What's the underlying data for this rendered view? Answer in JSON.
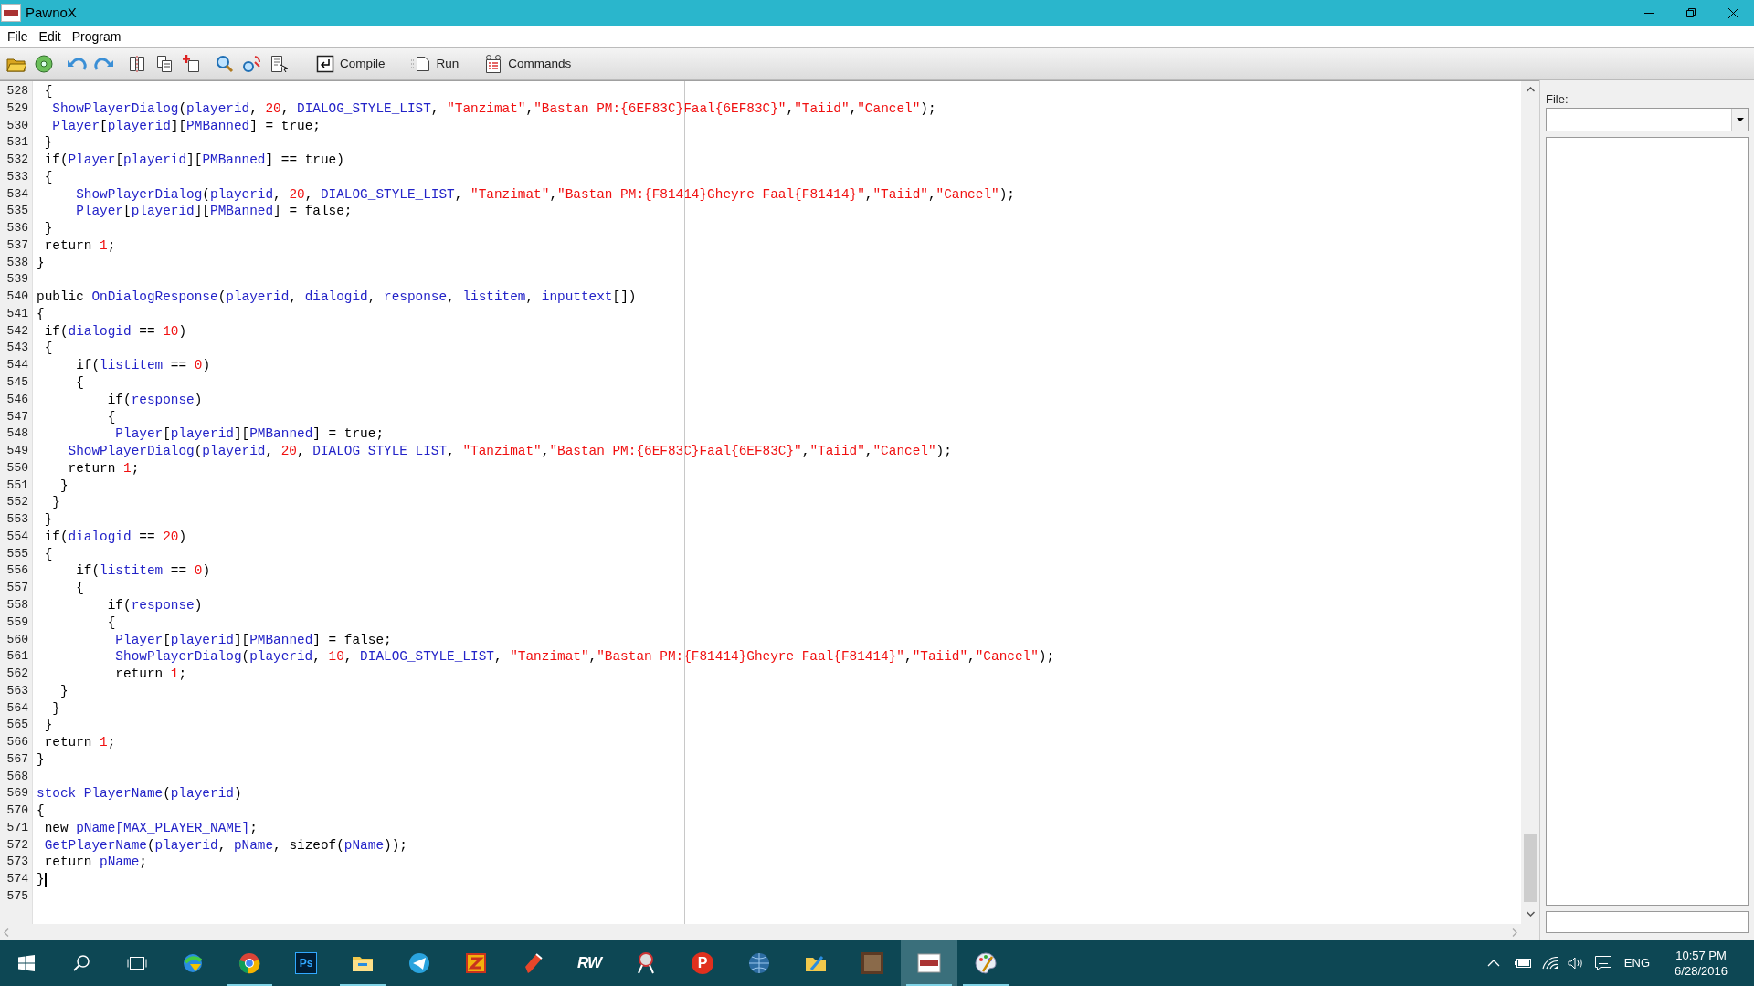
{
  "window": {
    "title": "PawnoX"
  },
  "menu": [
    {
      "label": "File"
    },
    {
      "label": "Edit"
    },
    {
      "label": "Program"
    }
  ],
  "toolbar": [
    {
      "kind": "open"
    },
    {
      "kind": "save"
    },
    {
      "kind": "undo"
    },
    {
      "kind": "redo"
    },
    {
      "kind": "cut"
    },
    {
      "kind": "copy"
    },
    {
      "kind": "paste"
    },
    {
      "kind": "find"
    },
    {
      "kind": "replace"
    },
    {
      "kind": "goto"
    },
    {
      "kind": "compile",
      "label": "Compile"
    },
    {
      "kind": "run",
      "label": "Run"
    },
    {
      "kind": "commands",
      "label": "Commands"
    }
  ],
  "editor": {
    "lines": [
      {
        "number": "528",
        "caret": false,
        "segments": [
          {
            "kind": "plain",
            "text": " {"
          }
        ]
      },
      {
        "number": "529",
        "caret": false,
        "segments": [
          {
            "kind": "name",
            "text": "  ShowPlayerDialog"
          },
          {
            "kind": "plain",
            "text": "("
          },
          {
            "kind": "name",
            "text": "playerid"
          },
          {
            "kind": "plain",
            "text": ", "
          },
          {
            "kind": "number",
            "text": "20"
          },
          {
            "kind": "plain",
            "text": ", "
          },
          {
            "kind": "name",
            "text": "DIALOG_STYLE_LIST"
          },
          {
            "kind": "plain",
            "text": ", "
          },
          {
            "kind": "string",
            "text": "\"Tanzimat\""
          },
          {
            "kind": "plain",
            "text": ","
          },
          {
            "kind": "string",
            "text": "\"Bastan PM:{6EF83C}Faal{6EF83C}\""
          },
          {
            "kind": "plain",
            "text": ","
          },
          {
            "kind": "string",
            "text": "\"Taiid\""
          },
          {
            "kind": "plain",
            "text": ","
          },
          {
            "kind": "string",
            "text": "\"Cancel\""
          },
          {
            "kind": "plain",
            "text": ");"
          }
        ]
      },
      {
        "number": "530",
        "caret": false,
        "segments": [
          {
            "kind": "name",
            "text": "  Player"
          },
          {
            "kind": "plain",
            "text": "["
          },
          {
            "kind": "name",
            "text": "playerid"
          },
          {
            "kind": "plain",
            "text": "]["
          },
          {
            "kind": "name",
            "text": "PMBanned"
          },
          {
            "kind": "plain",
            "text": "] = true;"
          }
        ]
      },
      {
        "number": "531",
        "caret": false,
        "segments": [
          {
            "kind": "plain",
            "text": " }"
          }
        ]
      },
      {
        "number": "532",
        "caret": false,
        "segments": [
          {
            "kind": "plain",
            "text": " if("
          },
          {
            "kind": "name",
            "text": "Player"
          },
          {
            "kind": "plain",
            "text": "["
          },
          {
            "kind": "name",
            "text": "playerid"
          },
          {
            "kind": "plain",
            "text": "]["
          },
          {
            "kind": "name",
            "text": "PMBanned"
          },
          {
            "kind": "plain",
            "text": "] == true)"
          }
        ]
      },
      {
        "number": "533",
        "caret": false,
        "segments": [
          {
            "kind": "plain",
            "text": " {"
          }
        ]
      },
      {
        "number": "534",
        "caret": false,
        "segments": [
          {
            "kind": "name",
            "text": "     ShowPlayerDialog"
          },
          {
            "kind": "plain",
            "text": "("
          },
          {
            "kind": "name",
            "text": "playerid"
          },
          {
            "kind": "plain",
            "text": ", "
          },
          {
            "kind": "number",
            "text": "20"
          },
          {
            "kind": "plain",
            "text": ", "
          },
          {
            "kind": "name",
            "text": "DIALOG_STYLE_LIST"
          },
          {
            "kind": "plain",
            "text": ", "
          },
          {
            "kind": "string",
            "text": "\"Tanzimat\""
          },
          {
            "kind": "plain",
            "text": ","
          },
          {
            "kind": "string",
            "text": "\"Bastan PM:{F81414}Gheyre Faal{F81414}\""
          },
          {
            "kind": "plain",
            "text": ","
          },
          {
            "kind": "string",
            "text": "\"Taiid\""
          },
          {
            "kind": "plain",
            "text": ","
          },
          {
            "kind": "string",
            "text": "\"Cancel\""
          },
          {
            "kind": "plain",
            "text": ");"
          }
        ]
      },
      {
        "number": "535",
        "caret": false,
        "segments": [
          {
            "kind": "name",
            "text": "     Player"
          },
          {
            "kind": "plain",
            "text": "["
          },
          {
            "kind": "name",
            "text": "playerid"
          },
          {
            "kind": "plain",
            "text": "]["
          },
          {
            "kind": "name",
            "text": "PMBanned"
          },
          {
            "kind": "plain",
            "text": "] = false;"
          }
        ]
      },
      {
        "number": "536",
        "caret": false,
        "segments": [
          {
            "kind": "plain",
            "text": " }"
          }
        ]
      },
      {
        "number": "537",
        "caret": false,
        "segments": [
          {
            "kind": "plain",
            "text": " return "
          },
          {
            "kind": "number",
            "text": "1"
          },
          {
            "kind": "plain",
            "text": ";"
          }
        ]
      },
      {
        "number": "538",
        "caret": false,
        "segments": [
          {
            "kind": "plain",
            "text": "}"
          }
        ]
      },
      {
        "number": "539",
        "caret": false
      },
      {
        "number": "540",
        "caret": false,
        "segments": [
          {
            "kind": "plain",
            "text": "public "
          },
          {
            "kind": "name",
            "text": "OnDialogResponse"
          },
          {
            "kind": "plain",
            "text": "("
          },
          {
            "kind": "name",
            "text": "playerid"
          },
          {
            "kind": "plain",
            "text": ", "
          },
          {
            "kind": "name",
            "text": "dialogid"
          },
          {
            "kind": "plain",
            "text": ", "
          },
          {
            "kind": "name",
            "text": "response"
          },
          {
            "kind": "plain",
            "text": ", "
          },
          {
            "kind": "name",
            "text": "listitem"
          },
          {
            "kind": "plain",
            "text": ", "
          },
          {
            "kind": "name",
            "text": "inputtext"
          },
          {
            "kind": "plain",
            "text": "[])"
          }
        ]
      },
      {
        "number": "541",
        "caret": false,
        "segments": [
          {
            "kind": "plain",
            "text": "{"
          }
        ]
      },
      {
        "number": "542",
        "caret": false,
        "segments": [
          {
            "kind": "plain",
            "text": " if("
          },
          {
            "kind": "name",
            "text": "dialogid"
          },
          {
            "kind": "plain",
            "text": " == "
          },
          {
            "kind": "number",
            "text": "10"
          },
          {
            "kind": "plain",
            "text": ")"
          }
        ]
      },
      {
        "number": "543",
        "caret": false,
        "segments": [
          {
            "kind": "plain",
            "text": " {"
          }
        ]
      },
      {
        "number": "544",
        "caret": false,
        "segments": [
          {
            "kind": "plain",
            "text": "     if("
          },
          {
            "kind": "name",
            "text": "listitem"
          },
          {
            "kind": "plain",
            "text": " == "
          },
          {
            "kind": "number",
            "text": "0"
          },
          {
            "kind": "plain",
            "text": ")"
          }
        ]
      },
      {
        "number": "545",
        "caret": false,
        "segments": [
          {
            "kind": "plain",
            "text": "     {"
          }
        ]
      },
      {
        "number": "546",
        "caret": false,
        "segments": [
          {
            "kind": "plain",
            "text": "         if("
          },
          {
            "kind": "name",
            "text": "response"
          },
          {
            "kind": "plain",
            "text": ")"
          }
        ]
      },
      {
        "number": "547",
        "caret": false,
        "segments": [
          {
            "kind": "plain",
            "text": "         {"
          }
        ]
      },
      {
        "number": "548",
        "caret": false,
        "segments": [
          {
            "kind": "name",
            "text": "          Player"
          },
          {
            "kind": "plain",
            "text": "["
          },
          {
            "kind": "name",
            "text": "playerid"
          },
          {
            "kind": "plain",
            "text": "]["
          },
          {
            "kind": "name",
            "text": "PMBanned"
          },
          {
            "kind": "plain",
            "text": "] = true;"
          }
        ]
      },
      {
        "number": "549",
        "caret": false,
        "segments": [
          {
            "kind": "name",
            "text": "    ShowPlayerDialog"
          },
          {
            "kind": "plain",
            "text": "("
          },
          {
            "kind": "name",
            "text": "playerid"
          },
          {
            "kind": "plain",
            "text": ", "
          },
          {
            "kind": "number",
            "text": "20"
          },
          {
            "kind": "plain",
            "text": ", "
          },
          {
            "kind": "name",
            "text": "DIALOG_STYLE_LIST"
          },
          {
            "kind": "plain",
            "text": ", "
          },
          {
            "kind": "string",
            "text": "\"Tanzimat\""
          },
          {
            "kind": "plain",
            "text": ","
          },
          {
            "kind": "string",
            "text": "\"Bastan PM:{6EF83C}Faal{6EF83C}\""
          },
          {
            "kind": "plain",
            "text": ","
          },
          {
            "kind": "string",
            "text": "\"Taiid\""
          },
          {
            "kind": "plain",
            "text": ","
          },
          {
            "kind": "string",
            "text": "\"Cancel\""
          },
          {
            "kind": "plain",
            "text": ");"
          }
        ]
      },
      {
        "number": "550",
        "caret": false,
        "segments": [
          {
            "kind": "plain",
            "text": "    return "
          },
          {
            "kind": "number",
            "text": "1"
          },
          {
            "kind": "plain",
            "text": ";"
          }
        ]
      },
      {
        "number": "551",
        "caret": false,
        "segments": [
          {
            "kind": "plain",
            "text": "   }"
          }
        ]
      },
      {
        "number": "552",
        "caret": false,
        "segments": [
          {
            "kind": "plain",
            "text": "  }"
          }
        ]
      },
      {
        "number": "553",
        "caret": false,
        "segments": [
          {
            "kind": "plain",
            "text": " }"
          }
        ]
      },
      {
        "number": "554",
        "caret": false,
        "segments": [
          {
            "kind": "plain",
            "text": " if("
          },
          {
            "kind": "name",
            "text": "dialogid"
          },
          {
            "kind": "plain",
            "text": " == "
          },
          {
            "kind": "number",
            "text": "20"
          },
          {
            "kind": "plain",
            "text": ")"
          }
        ]
      },
      {
        "number": "555",
        "caret": false,
        "segments": [
          {
            "kind": "plain",
            "text": " {"
          }
        ]
      },
      {
        "number": "556",
        "caret": false,
        "segments": [
          {
            "kind": "plain",
            "text": "     if("
          },
          {
            "kind": "name",
            "text": "listitem"
          },
          {
            "kind": "plain",
            "text": " == "
          },
          {
            "kind": "number",
            "text": "0"
          },
          {
            "kind": "plain",
            "text": ")"
          }
        ]
      },
      {
        "number": "557",
        "caret": false,
        "segments": [
          {
            "kind": "plain",
            "text": "     {"
          }
        ]
      },
      {
        "number": "558",
        "caret": false,
        "segments": [
          {
            "kind": "plain",
            "text": "         if("
          },
          {
            "kind": "name",
            "text": "response"
          },
          {
            "kind": "plain",
            "text": ")"
          }
        ]
      },
      {
        "number": "559",
        "caret": false,
        "segments": [
          {
            "kind": "plain",
            "text": "         {"
          }
        ]
      },
      {
        "number": "560",
        "caret": false,
        "segments": [
          {
            "kind": "name",
            "text": "          Player"
          },
          {
            "kind": "plain",
            "text": "["
          },
          {
            "kind": "name",
            "text": "playerid"
          },
          {
            "kind": "plain",
            "text": "]["
          },
          {
            "kind": "name",
            "text": "PMBanned"
          },
          {
            "kind": "plain",
            "text": "] = false;"
          }
        ]
      },
      {
        "number": "561",
        "caret": false,
        "segments": [
          {
            "kind": "name",
            "text": "          ShowPlayerDialog"
          },
          {
            "kind": "plain",
            "text": "("
          },
          {
            "kind": "name",
            "text": "playerid"
          },
          {
            "kind": "plain",
            "text": ", "
          },
          {
            "kind": "number",
            "text": "10"
          },
          {
            "kind": "plain",
            "text": ", "
          },
          {
            "kind": "name",
            "text": "DIALOG_STYLE_LIST"
          },
          {
            "kind": "plain",
            "text": ", "
          },
          {
            "kind": "string",
            "text": "\"Tanzimat\""
          },
          {
            "kind": "plain",
            "text": ","
          },
          {
            "kind": "string",
            "text": "\"Bastan PM:{F81414}Gheyre Faal{F81414}\""
          },
          {
            "kind": "plain",
            "text": ","
          },
          {
            "kind": "string",
            "text": "\"Taiid\""
          },
          {
            "kind": "plain",
            "text": ","
          },
          {
            "kind": "string",
            "text": "\"Cancel\""
          },
          {
            "kind": "plain",
            "text": ");"
          }
        ]
      },
      {
        "number": "562",
        "caret": false,
        "segments": [
          {
            "kind": "plain",
            "text": "          return "
          },
          {
            "kind": "number",
            "text": "1"
          },
          {
            "kind": "plain",
            "text": ";"
          }
        ]
      },
      {
        "number": "563",
        "caret": false,
        "segments": [
          {
            "kind": "plain",
            "text": "   }"
          }
        ]
      },
      {
        "number": "564",
        "caret": false,
        "segments": [
          {
            "kind": "plain",
            "text": "  }"
          }
        ]
      },
      {
        "number": "565",
        "caret": false,
        "segments": [
          {
            "kind": "plain",
            "text": " }"
          }
        ]
      },
      {
        "number": "566",
        "caret": false,
        "segments": [
          {
            "kind": "plain",
            "text": " return "
          },
          {
            "kind": "number",
            "text": "1"
          },
          {
            "kind": "plain",
            "text": ";"
          }
        ]
      },
      {
        "number": "567",
        "caret": false,
        "segments": [
          {
            "kind": "plain",
            "text": "}"
          }
        ]
      },
      {
        "number": "568",
        "caret": false
      },
      {
        "number": "569",
        "caret": false,
        "segments": [
          {
            "kind": "name",
            "text": "stock PlayerName"
          },
          {
            "kind": "plain",
            "text": "("
          },
          {
            "kind": "name",
            "text": "playerid"
          },
          {
            "kind": "plain",
            "text": ")"
          }
        ]
      },
      {
        "number": "570",
        "caret": false,
        "segments": [
          {
            "kind": "plain",
            "text": "{"
          }
        ]
      },
      {
        "number": "571",
        "caret": false,
        "segments": [
          {
            "kind": "plain",
            "text": " new "
          },
          {
            "kind": "name",
            "text": "pName[MAX_PLAYER_NAME]"
          },
          {
            "kind": "plain",
            "text": ";"
          }
        ]
      },
      {
        "number": "572",
        "caret": false,
        "segments": [
          {
            "kind": "name",
            "text": " GetPlayerName"
          },
          {
            "kind": "plain",
            "text": "("
          },
          {
            "kind": "name",
            "text": "playerid"
          },
          {
            "kind": "plain",
            "text": ", "
          },
          {
            "kind": "name",
            "text": "pName"
          },
          {
            "kind": "plain",
            "text": ", sizeof("
          },
          {
            "kind": "name",
            "text": "pName"
          },
          {
            "kind": "plain",
            "text": "));"
          }
        ]
      },
      {
        "number": "573",
        "caret": false,
        "segments": [
          {
            "kind": "plain",
            "text": " return "
          },
          {
            "kind": "name",
            "text": "pName"
          },
          {
            "kind": "plain",
            "text": ";"
          }
        ]
      },
      {
        "number": "574",
        "caret": true,
        "segments": [
          {
            "kind": "plain",
            "text": "}"
          }
        ]
      },
      {
        "number": "575",
        "caret": false
      }
    ]
  },
  "side_panel": {
    "file_label": "File:"
  },
  "taskbar": {
    "apps": [
      {
        "kind": "downloader",
        "running": false,
        "selected": false
      },
      {
        "kind": "chrome",
        "running": true,
        "selected": false
      },
      {
        "kind": "photoshop",
        "glyph": "Ps",
        "running": false,
        "selected": false
      },
      {
        "kind": "explorer",
        "running": true,
        "selected": false
      },
      {
        "kind": "telegram",
        "running": false,
        "selected": false
      },
      {
        "kind": "filezilla",
        "running": false,
        "selected": false
      },
      {
        "kind": "pen",
        "running": false,
        "selected": false
      },
      {
        "kind": "rw",
        "glyph": "RW",
        "running": false,
        "selected": false
      },
      {
        "kind": "snip",
        "running": false,
        "selected": false
      },
      {
        "kind": "psiphon",
        "glyph": "P",
        "running": false,
        "selected": false
      },
      {
        "kind": "globe",
        "running": false,
        "selected": false
      },
      {
        "kind": "folder",
        "running": false,
        "selected": false
      },
      {
        "kind": "photo",
        "running": false,
        "selected": false
      },
      {
        "kind": "pawno",
        "running": true,
        "selected": true
      },
      {
        "kind": "paint",
        "running": true,
        "selected": false
      }
    ],
    "language": "ENG",
    "time": "10:57 PM",
    "date": "6/28/2016"
  }
}
